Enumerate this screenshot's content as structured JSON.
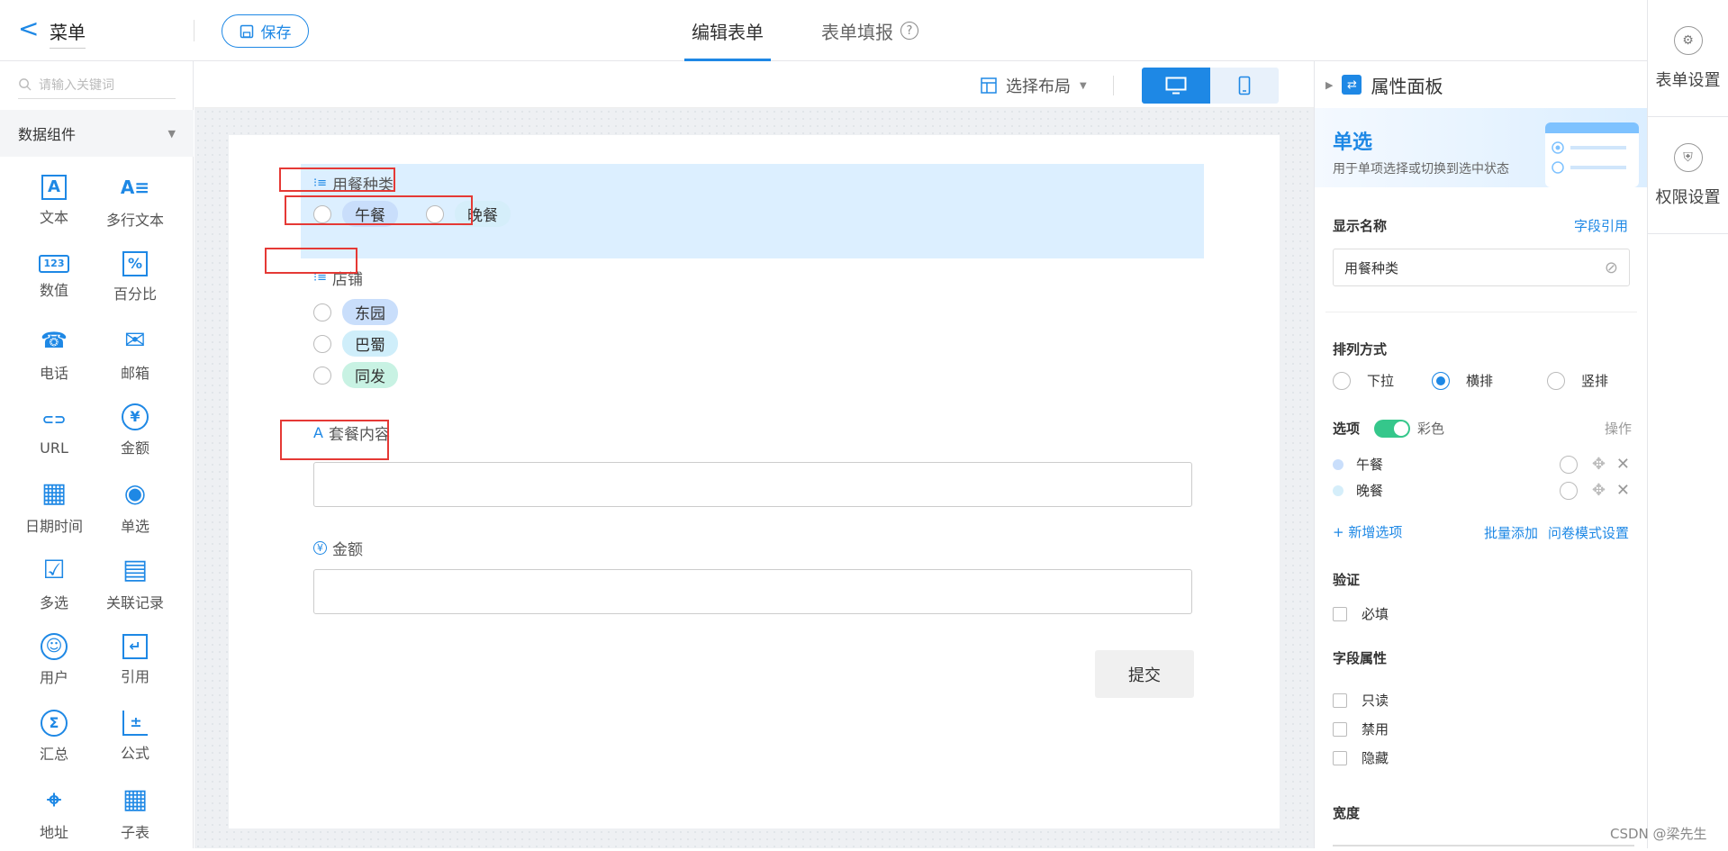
{
  "header": {
    "back_label": "<",
    "title": "菜单",
    "save_label": "保存",
    "tabs": [
      {
        "label": "编辑表单"
      },
      {
        "label": "表单填报"
      }
    ],
    "help_icon": "?"
  },
  "rail": {
    "items": [
      {
        "label": "表单设置"
      },
      {
        "label": "权限设置"
      }
    ]
  },
  "left": {
    "search_placeholder": "请输入关键词",
    "group_label": "数据组件",
    "components": [
      {
        "label": "文本",
        "icon": "A"
      },
      {
        "label": "多行文本",
        "icon": "A≡"
      },
      {
        "label": "数值",
        "icon": "123"
      },
      {
        "label": "百分比",
        "icon": "%"
      },
      {
        "label": "电话",
        "icon": "☎"
      },
      {
        "label": "邮箱",
        "icon": "✉"
      },
      {
        "label": "URL",
        "icon": "⊂⊃"
      },
      {
        "label": "金额",
        "icon": "¥"
      },
      {
        "label": "日期时间",
        "icon": "▦"
      },
      {
        "label": "单选",
        "icon": "◉"
      },
      {
        "label": "多选",
        "icon": "☑"
      },
      {
        "label": "关联记录",
        "icon": "▤"
      },
      {
        "label": "用户",
        "icon": "☺"
      },
      {
        "label": "引用",
        "icon": "↵"
      },
      {
        "label": "汇总",
        "icon": "Σ"
      },
      {
        "label": "公式",
        "icon": "±"
      },
      {
        "label": "地址",
        "icon": "⌖"
      },
      {
        "label": "子表",
        "icon": "▦"
      }
    ]
  },
  "toolbar": {
    "layout_label": "选择布局",
    "desktop_icon": "▭",
    "mobile_icon": "▯"
  },
  "form": {
    "field1": {
      "label": "用餐种类",
      "options": [
        "午餐",
        "晚餐"
      ]
    },
    "field2": {
      "label": "店铺",
      "options": [
        "东园",
        "巴蜀",
        "同发"
      ]
    },
    "field3": {
      "label": "套餐内容",
      "icon": "A"
    },
    "field4": {
      "label": "金额",
      "icon": "¥"
    },
    "submit_label": "提交"
  },
  "props": {
    "header": "属性面板",
    "banner_title": "单选",
    "banner_desc": "用于单项选择或切换到选中状态",
    "display_name_label": "显示名称",
    "field_ref": "字段引用",
    "display_name_value": "用餐种类",
    "arrange_label": "排列方式",
    "arrange_options": [
      "下拉",
      "横排",
      "竖排"
    ],
    "options_label": "选项",
    "color_label": "彩色",
    "ops_label": "操作",
    "option_items": [
      {
        "label": "午餐",
        "color": "#c9defb"
      },
      {
        "label": "晚餐",
        "color": "#d5eefa"
      }
    ],
    "add_option": "+ 新增选项",
    "batch_add": "批量添加",
    "survey_mode": "问卷模式设置",
    "validate_label": "验证",
    "required_label": "必填",
    "field_attr_label": "字段属性",
    "attrs": [
      "只读",
      "禁用",
      "隐藏"
    ],
    "width_label": "宽度"
  },
  "colors": {
    "accent": "#1e88e5",
    "pill_east": "#c9defb",
    "pill_bashu": "#cfeefa",
    "pill_tongfa": "#c8f2e3"
  },
  "watermark": "CSDN @梁先生"
}
